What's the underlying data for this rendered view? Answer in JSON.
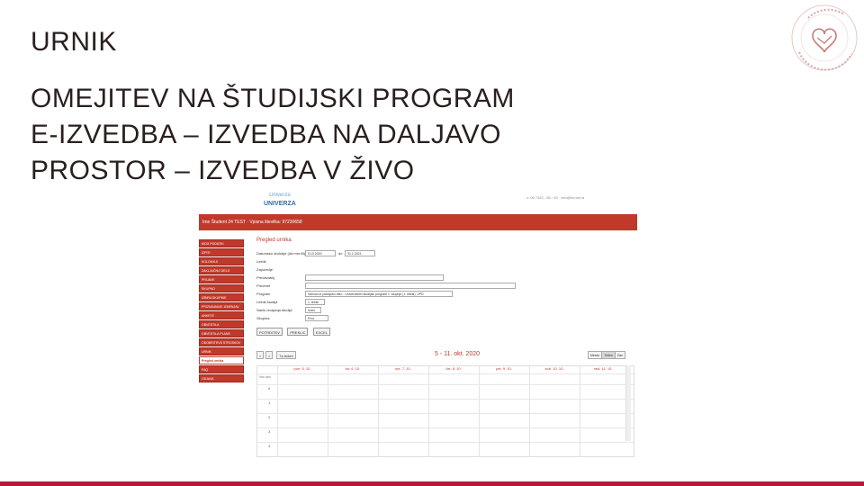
{
  "slide": {
    "title": "URNIK",
    "lines": [
      "OMEJITEV NA ŠTUDIJSKI PROGRAM",
      "E-IZVEDBA – IZVEDBA NA DALJAVO",
      "PROSTOR – IZVEDBA V ŽIVO"
    ]
  },
  "colors": {
    "accent": "#b8173a",
    "app_red": "#c0392b",
    "link_blue": "#2f6ea8"
  },
  "screenshot": {
    "logo_text": [
      "Univerza",
      "UNIVERZA"
    ],
    "contact": "c: 06 7420 - 56 - 63 · info@fvv.um.si",
    "user_bar": "Ime Študent 24 TEST · Vpisna številka: 97230658",
    "sidebar": [
      "MOJI PODATKI",
      "IZPITI",
      "KOLOKVIJI",
      "ZAKLJUČNO DELO",
      "PRIJAVE",
      "SKUPNO",
      "IZBIRA SKUPINE",
      "PRIZNAVANJE IZMENJAV",
      "ANKETE",
      "OBVESTILA",
      "OBVESTILA PLANS",
      "ODOBRITEVS STROSKOV",
      "URNIK",
      "Pregled urnika",
      "FAQ",
      "ODJAVA"
    ],
    "active_item": "Pregled urnika",
    "page_title": "Pregled urnika",
    "form": [
      {
        "label": "Datumsko obdobje (dd.mm.llll)",
        "from": "5.10.2020",
        "to_label": "do",
        "to": "31.1.2021"
      },
      {
        "label": "Letnik",
        "value": ""
      },
      {
        "label": "Zaporedje",
        "value": ""
      },
      {
        "label": "Predavatelj",
        "value": ""
      },
      {
        "label": "Predmet",
        "value": ""
      },
      {
        "label": "Program",
        "value": "Varnost in policijsko delo - Univerzitetni študijski program 1. stopnje (1. letnik), VPD"
      },
      {
        "label": "Letnik študija",
        "value": "1. letnik"
      },
      {
        "label": "Način izvajanja študija",
        "value": "redni"
      },
      {
        "label": "Skupina",
        "value": "Prvo"
      }
    ],
    "buttons": [
      "POTRDITEV",
      "PREKLIC",
      "EXCEL"
    ],
    "calendar": {
      "prev": "<",
      "next": ">",
      "today": "Tа teden",
      "title": "5 - 11. okt. 2020",
      "views": [
        "Mesec",
        "Teden",
        "Dan"
      ],
      "active_view": "Teden",
      "days": [
        "pon. 5. 10.",
        "tor. 6. 10.",
        "sre. 7. 10.",
        "čet. 8. 10.",
        "pet. 9. 10.",
        "sob. 10. 10.",
        "ned. 11. 10."
      ],
      "allday": "Ves dan",
      "hours": [
        "0",
        "1",
        "2",
        "3",
        "4"
      ]
    }
  }
}
